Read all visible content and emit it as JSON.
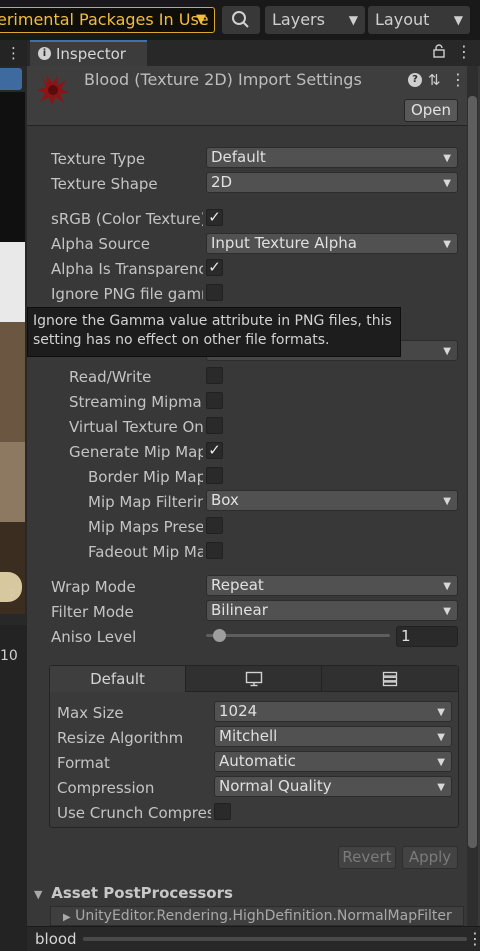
{
  "toolbar": {
    "packages_label": "erimental Packages In Use",
    "layers_label": "Layers",
    "layout_label": "Layout",
    "accent_color": "#f2bd3c"
  },
  "left_panel": {
    "tab_label": "⋮",
    "zoom_value": "10"
  },
  "inspector": {
    "tab_label": "Inspector",
    "title": "Blood (Texture 2D) Import Settings",
    "open_label": "Open"
  },
  "fields": {
    "texture_type": {
      "label": "Texture Type",
      "value": "Default"
    },
    "texture_shape": {
      "label": "Texture Shape",
      "value": "2D"
    },
    "srgb": {
      "label": "sRGB (Color Texture)",
      "checked": true
    },
    "alpha_source": {
      "label": "Alpha Source",
      "value": "Input Texture Alpha"
    },
    "alpha_transparency": {
      "label": "Alpha Is Transparenc",
      "checked": true
    },
    "ignore_png": {
      "label": "Ignore PNG file gamm",
      "checked": false
    },
    "read_write": {
      "label": "Read/Write",
      "checked": false
    },
    "streaming_mipmaps": {
      "label": "Streaming Mipmap",
      "checked": false
    },
    "virtual_texture": {
      "label": "Virtual Texture Onl",
      "checked": false
    },
    "generate_mip": {
      "label": "Generate Mip Map",
      "checked": true
    },
    "border_mip": {
      "label": "Border Mip Maps",
      "checked": false
    },
    "mip_filtering": {
      "label": "Mip Map Filterin",
      "value": "Box"
    },
    "mip_preserve": {
      "label": "Mip Maps Prese",
      "checked": false
    },
    "fadeout_mip": {
      "label": "Fadeout Mip Ma",
      "checked": false
    },
    "wrap_mode": {
      "label": "Wrap Mode",
      "value": "Repeat"
    },
    "filter_mode": {
      "label": "Filter Mode",
      "value": "Bilinear"
    },
    "aniso_level": {
      "label": "Aniso Level",
      "value": "1",
      "slider_fraction": 0.07
    }
  },
  "tooltip": "Ignore the Gamma value attribute in PNG files, this setting has no effect on other file formats.",
  "platform": {
    "tabs": [
      {
        "label": "Default",
        "icon": ""
      },
      {
        "label": "",
        "icon": "monitor-icon"
      },
      {
        "label": "",
        "icon": "server-icon"
      }
    ],
    "max_size": {
      "label": "Max Size",
      "value": "1024"
    },
    "resize": {
      "label": "Resize Algorithm",
      "value": "Mitchell"
    },
    "format": {
      "label": "Format",
      "value": "Automatic"
    },
    "compression": {
      "label": "Compression",
      "value": "Normal Quality"
    },
    "crunch": {
      "label": "Use Crunch Compres",
      "checked": false
    }
  },
  "buttons": {
    "revert": "Revert",
    "apply": "Apply"
  },
  "postprocessors": {
    "header": "Asset PostProcessors",
    "item": "UnityEditor.Rendering.HighDefinition.NormalMapFilter"
  },
  "status_bar": {
    "label": "blood"
  }
}
